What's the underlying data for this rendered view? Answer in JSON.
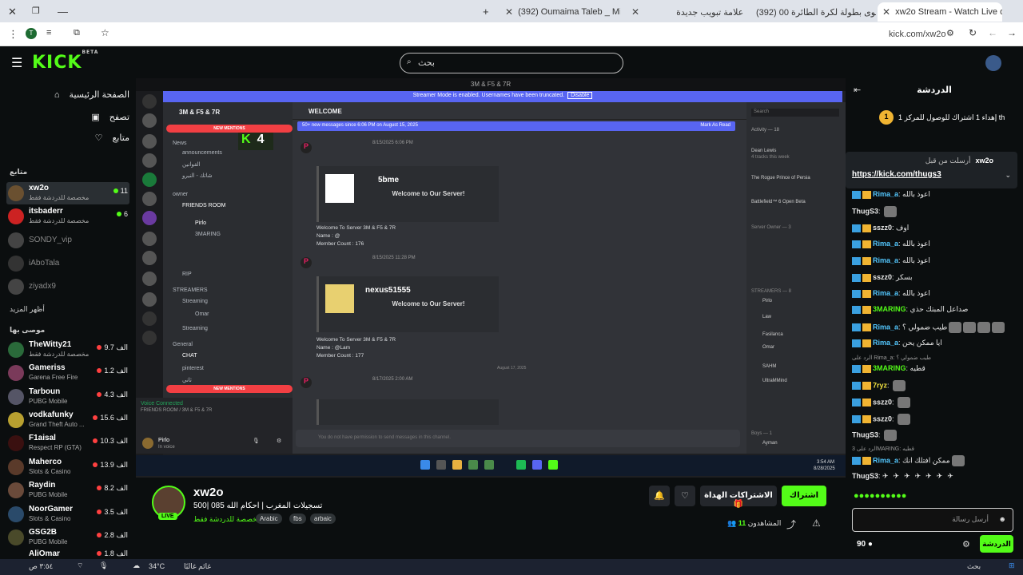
{
  "browser": {
    "tabs": [
      {
        "label": "xw2o Stream - Watch Live on K",
        "active": true
      },
      {
        "label": "(392) اقوى بطولة لكرة الطائرة 00",
        "active": false
      },
      {
        "label": "علامة تبويب جديدة",
        "active": false
      },
      {
        "label": "(392) Oumaima Taleb _ Mi",
        "active": false
      }
    ],
    "url": "kick.com/xw2o",
    "profile_initial": "T"
  },
  "topnav": {
    "logo": "KICK",
    "beta": "BETA",
    "search_placeholder": "بحث"
  },
  "sidebar": {
    "nav": [
      {
        "label": "الصفحة الرئيسية",
        "icon": "home-icon"
      },
      {
        "label": "تصفح",
        "icon": "browse-icon"
      },
      {
        "label": "متابع",
        "icon": "heart-icon"
      }
    ],
    "following_title": "متابع",
    "following": [
      {
        "name": "xw2o",
        "sub": "مخصصة للدردشة فقط",
        "viewers": "11",
        "active": true
      },
      {
        "name": "itsbaderr",
        "sub": "مخصصة للدردشة فقط",
        "viewers": "6"
      },
      {
        "name": "SONDY_vip",
        "sub": "",
        "viewers": ""
      },
      {
        "name": "iAboTala",
        "sub": "",
        "viewers": ""
      },
      {
        "name": "ziyadx9",
        "sub": "",
        "viewers": ""
      }
    ],
    "show_more": "أظهر المزيد",
    "recommended_title": "موصى بها",
    "recommended": [
      {
        "name": "TheWitty21",
        "sub": "مخصصة للدردشة فقط",
        "viewers": "9.7 الف"
      },
      {
        "name": "Gameriss",
        "sub": "Garena Free Fire",
        "viewers": "1.2 الف"
      },
      {
        "name": "Tarboun",
        "sub": "PUBG Mobile",
        "viewers": "4.3 الف"
      },
      {
        "name": "vodkafunky",
        "sub": "Grand Theft Auto ...",
        "viewers": "15.6 الف"
      },
      {
        "name": "F1aisal",
        "sub": "Respect RP (GTA)",
        "viewers": "10.3 الف"
      },
      {
        "name": "Maherco",
        "sub": "Slots & Casino",
        "viewers": "13.9 الف"
      },
      {
        "name": "Raydin",
        "sub": "PUBG Mobile",
        "viewers": "8.2 الف"
      },
      {
        "name": "NoorGamer",
        "sub": "Slots & Casino",
        "viewers": "3.5 الف"
      },
      {
        "name": "GSG2B",
        "sub": "PUBG Mobile",
        "viewers": "2.8 الف"
      },
      {
        "name": "AliOmar",
        "sub": "",
        "viewers": "1.8 الف"
      }
    ]
  },
  "video": {
    "window_title": "3M & F5 & 7R",
    "banner": "Streamer Mode is enabled. Usernames have been truncated.",
    "banner_btn": "Disable",
    "server_name": "3M & F5 & 7R",
    "new_mentions": "NEW MENTIONS",
    "channels": [
      "News",
      "announcements",
      "القوانين",
      "شاتك - النيرو",
      "owner",
      "FRIENDS ROOM",
      "Pirlo",
      "3MARING",
      "RIP",
      "STREAMERS",
      "Streaming",
      "Omar",
      "Streaming",
      "General",
      "CHAT",
      "pinterest",
      "ثاني"
    ],
    "voice_connected": "Voice Connected",
    "voice_channel": "FRIENDS ROOM / 3M & F5 & 7R",
    "self_user": "Pirlo",
    "self_status": "In voice",
    "channel_header": "WELCOME",
    "new_messages": "50+ new messages since 6:06 PM on August 15, 2025",
    "mark_read": "Mark As Read",
    "embeds": [
      {
        "time": "8/15/2025 6:06 PM",
        "user": "5bme",
        "welcome": "Welcome to Our Server!",
        "lines": [
          "Welcome To Server 3M & F5 & 7R",
          "Name : @",
          "Member Count : 176"
        ]
      },
      {
        "time": "8/15/2025 11:28 PM",
        "user": "nexus51555",
        "welcome": "Welcome to Our Server!",
        "lines": [
          "Welcome To Server 3M & F5 & 7R",
          "Name : @Lam",
          "Member Count : 177"
        ]
      }
    ],
    "date_divider": "August 17, 2025",
    "third_time": "8/17/2025 2:00 AM",
    "input_placeholder": "You do not have permission to send messages in this channel.",
    "search_placeholder": "Search",
    "activity": "Activity — 18",
    "members": [
      {
        "name": "Dean Lewis",
        "sub": "4 tracks this week"
      },
      {
        "name": "Sindy-vip",
        "sub": "The Rogue Prince of Persia"
      },
      {
        "name": "ABO TALA",
        "sub": "Battlefield™ 6 Open Beta"
      },
      {
        "name": "Server Owner — 3",
        "sub": ""
      },
      {
        "name": "STREAMERS — 8",
        "sub": ""
      },
      {
        "name": "Pirlo",
        "sub": ""
      },
      {
        "name": "Law",
        "sub": ""
      },
      {
        "name": "Fasilanca",
        "sub": ""
      },
      {
        "name": "Omar",
        "sub": "In voice"
      },
      {
        "name": "SAHM",
        "sub": ""
      },
      {
        "name": "UltraMMind",
        "sub": "UltraMind"
      },
      {
        "name": "Boys — 1",
        "sub": ""
      },
      {
        "name": "Ayman",
        "sub": "Playing Rocket League"
      }
    ],
    "clock_time": "3:54 AM",
    "clock_date": "8/28/2025",
    "overlay_k": "K",
    "overlay_num": "4"
  },
  "stream": {
    "name": "xw2o",
    "live": "LIVE",
    "title": "تسجيلات المغرب | احكام الله 085 |500",
    "category": "مخصصة للدردشة فقط",
    "tags": [
      "Arabic",
      "fbs",
      "arbaic"
    ],
    "subscribe": "اشتراك",
    "gift": "الاشتراكات الهداة",
    "viewers_label": "المشاهدون",
    "viewers": "11"
  },
  "chat": {
    "title": "الدردشة",
    "gift_count": "1",
    "gift_text": "إهداء 1 اشتراك للوصول للمركز 1 th",
    "pinned_user": "xw2o",
    "pinned_note": "أرسلت من قبل",
    "pinned_link": "https://kick.com/thugs3",
    "messages": [
      {
        "user": "Rima_a",
        "text": "اعوذ بالله",
        "color": "#53c8ff"
      },
      {
        "user": "ThugS3",
        "text": "",
        "color": "#ffffff"
      },
      {
        "user": "sszz0",
        "text": "اوف",
        "color": "#ffffff"
      },
      {
        "user": "Rima_a",
        "text": "اعوذ بالله",
        "color": "#53c8ff"
      },
      {
        "user": "Rima_a",
        "text": "اعوذ بالله",
        "color": "#53c8ff"
      },
      {
        "user": "sszz0",
        "text": "بسكر",
        "color": "#ffffff"
      },
      {
        "user": "Rima_a",
        "text": "اعوذ بالله",
        "color": "#53c8ff"
      },
      {
        "user": "3MARING",
        "text": "صداعل المبتك حذي",
        "color": "#53fc18"
      },
      {
        "user": "Rima_a",
        "text": "طيب ضمولي ؟",
        "color": "#53c8ff"
      },
      {
        "user": "Rima_a",
        "text": "ايا ممكن يحن",
        "color": "#53c8ff"
      },
      {
        "user": "3MARING",
        "text": "قطيه",
        "color": "#53fc18"
      },
      {
        "user": "7ryz",
        "text": "",
        "color": "#f0e040"
      },
      {
        "user": "sszz0",
        "text": "",
        "color": "#ffffff"
      },
      {
        "user": "sszz0",
        "text": "",
        "color": "#ffffff"
      },
      {
        "user": "ThugS3",
        "text": "",
        "color": "#ffffff"
      },
      {
        "user": "Rima_a",
        "text": "ممكن افتلك انك",
        "color": "#53c8ff"
      },
      {
        "user": "ThugS3",
        "text": "",
        "color": "#ffffff"
      }
    ],
    "reply_1": "الرد على Rima_a: طيب ضمولي ؟",
    "reply_2": "الرد على 3MARING: قطيه",
    "input_placeholder": "أرسل رسالة",
    "send_label": "الدردشة",
    "points": "90"
  },
  "taskbar": {
    "weather_temp": "34°C",
    "weather_text": "غائم غالبًا",
    "time": "٣:٥٤ ص",
    "search": "بحث"
  }
}
